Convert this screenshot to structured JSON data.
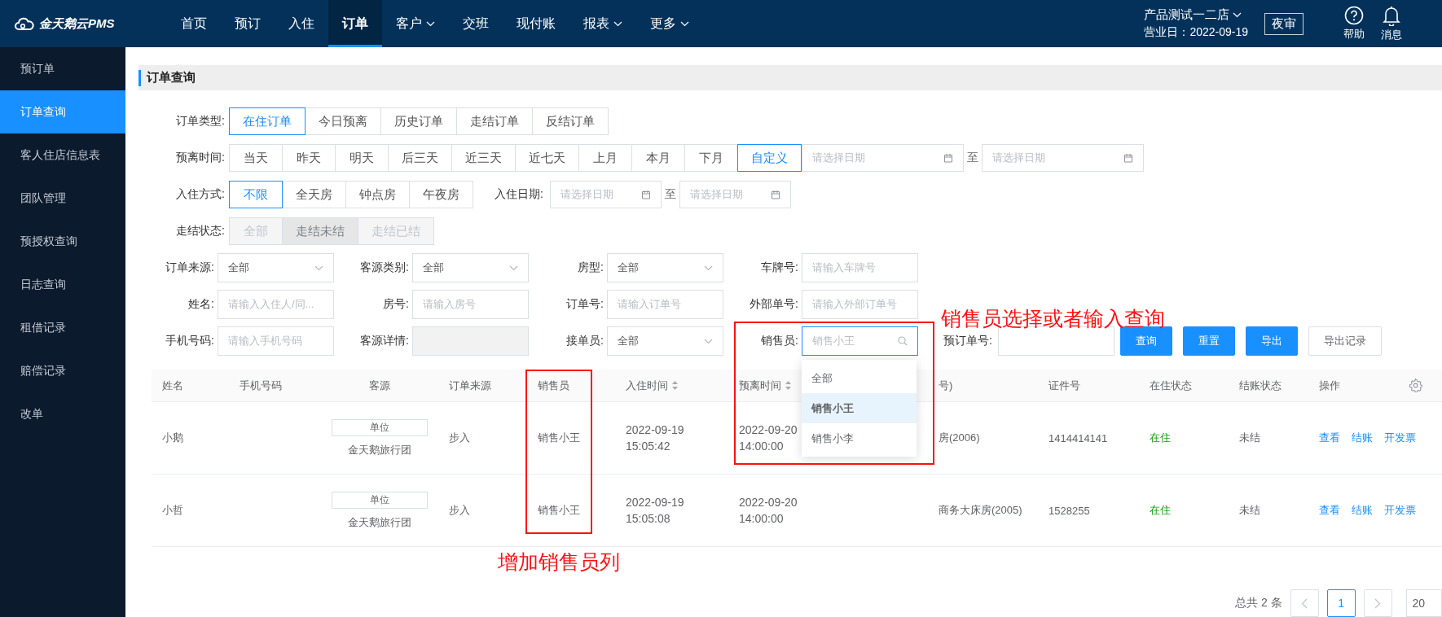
{
  "topbar": {
    "logo": "金天鹅云PMS",
    "nav": [
      {
        "label": "首页",
        "selected": false,
        "has_menu": false
      },
      {
        "label": "预订",
        "selected": false,
        "has_menu": false
      },
      {
        "label": "入住",
        "selected": false,
        "has_menu": false
      },
      {
        "label": "订单",
        "selected": true,
        "has_menu": false
      },
      {
        "label": "客户",
        "selected": false,
        "has_menu": true
      },
      {
        "label": "交班",
        "selected": false,
        "has_menu": false
      },
      {
        "label": "现付账",
        "selected": false,
        "has_menu": false
      },
      {
        "label": "报表",
        "selected": false,
        "has_menu": true
      },
      {
        "label": "更多",
        "selected": false,
        "has_menu": true
      }
    ],
    "store": "产品测试一二店",
    "business_day": "营业日：2022-09-19",
    "night_audit": "夜审",
    "tools": [
      {
        "kind": "help",
        "label": "帮助"
      },
      {
        "kind": "bell",
        "label": "消息"
      }
    ]
  },
  "sidebar": {
    "items": [
      {
        "label": "预订单",
        "selected": false
      },
      {
        "label": "订单查询",
        "selected": true
      },
      {
        "label": "客人住店信息表",
        "selected": false
      },
      {
        "label": "团队管理",
        "selected": false
      },
      {
        "label": "预授权查询",
        "selected": false
      },
      {
        "label": "日志查询",
        "selected": false
      },
      {
        "label": "租借记录",
        "selected": false
      },
      {
        "label": "赔偿记录",
        "selected": false
      },
      {
        "label": "改单",
        "selected": false
      }
    ]
  },
  "page_title": "订单查询",
  "filter_rows": [
    {
      "label": "订单类型:",
      "disabled": false,
      "options": [
        {
          "label": "在住订单",
          "selected": true
        },
        {
          "label": "今日预离",
          "selected": false
        },
        {
          "label": "历史订单",
          "selected": false
        },
        {
          "label": "走结订单",
          "selected": false
        },
        {
          "label": "反结订单",
          "selected": false
        }
      ]
    },
    {
      "label": "预离时间:",
      "disabled": false,
      "options": [
        {
          "label": "当天",
          "selected": false
        },
        {
          "label": "昨天",
          "selected": false
        },
        {
          "label": "明天",
          "selected": false
        },
        {
          "label": "后三天",
          "selected": false
        },
        {
          "label": "近三天",
          "selected": false
        },
        {
          "label": "近七天",
          "selected": false
        },
        {
          "label": "上月",
          "selected": false
        },
        {
          "label": "本月",
          "selected": false
        },
        {
          "label": "下月",
          "selected": false
        },
        {
          "label": "自定义",
          "selected": true
        }
      ],
      "date_range": {
        "start_placeholder": "请选择日期",
        "separator": "至",
        "end_placeholder": "请选择日期"
      }
    },
    {
      "label": "入住方式:",
      "disabled": false,
      "options": [
        {
          "label": "不限",
          "selected": true
        },
        {
          "label": "全天房",
          "selected": false
        },
        {
          "label": "钟点房",
          "selected": false
        },
        {
          "label": "午夜房",
          "selected": false
        }
      ],
      "date_range": {
        "label": "入住日期:",
        "start_placeholder": "请选择日期",
        "separator": "至",
        "end_placeholder": "请选择日期"
      }
    },
    {
      "label": "走结状态:",
      "disabled": true,
      "options": [
        {
          "label": "全部",
          "selected": false
        },
        {
          "label": "走结未结",
          "selected": true
        },
        {
          "label": "走结已结",
          "selected": false
        }
      ]
    }
  ],
  "field_rows": [
    [
      {
        "label": "订单来源:",
        "kind": "select",
        "value": "全部",
        "disabled": false,
        "focused": false
      },
      {
        "label": "客源类别:",
        "kind": "select",
        "value": "全部",
        "disabled": false,
        "focused": false
      },
      {
        "label": "房型:",
        "kind": "select",
        "value": "全部",
        "disabled": false,
        "focused": false
      },
      {
        "label": "车牌号:",
        "kind": "text",
        "placeholder": "请输入车牌号",
        "disabled": false,
        "focused": false
      }
    ],
    [
      {
        "label": "姓名:",
        "kind": "text",
        "placeholder": "请输入入住人/同...",
        "disabled": false,
        "focused": false
      },
      {
        "label": "房号:",
        "kind": "text",
        "placeholder": "请输入房号",
        "disabled": false,
        "focused": false
      },
      {
        "label": "订单号:",
        "kind": "text",
        "placeholder": "请输入订单号",
        "disabled": false,
        "focused": false
      },
      {
        "label": "外部单号:",
        "kind": "text",
        "placeholder": "请输入外部订单号",
        "disabled": false,
        "focused": false
      }
    ],
    [
      {
        "label": "手机号码:",
        "kind": "text",
        "placeholder": "请输入手机号码",
        "disabled": false,
        "focused": false
      },
      {
        "label": "客源详情:",
        "kind": "text",
        "disabled": true,
        "focused": false
      },
      {
        "label": "接单员:",
        "kind": "select",
        "value": "全部",
        "disabled": false,
        "focused": false
      },
      {
        "label": "销售员:",
        "kind": "search",
        "placeholder": "销售小王",
        "disabled": false,
        "focused": true,
        "options": [
          {
            "label": "全部",
            "selected": false
          },
          {
            "label": "销售小王",
            "selected": true
          },
          {
            "label": "销售小李",
            "selected": false
          }
        ]
      },
      {
        "label": "预订单号:",
        "kind": "text",
        "disabled": false,
        "focused": false
      }
    ]
  ],
  "actions": [
    {
      "label": "查询",
      "kind": "primary"
    },
    {
      "label": "重置",
      "kind": "primary"
    },
    {
      "label": "导出",
      "kind": "primary"
    },
    {
      "label": "导出记录",
      "kind": "default"
    }
  ],
  "table": {
    "columns": [
      {
        "label": "姓名",
        "sortable": false
      },
      {
        "label": "手机号码",
        "sortable": false
      },
      {
        "label": "客源",
        "sortable": false
      },
      {
        "label": "订单来源",
        "sortable": false
      },
      {
        "label": "销售员",
        "sortable": false
      },
      {
        "label": "入住时间",
        "sortable": true
      },
      {
        "label": "预离时间",
        "sortable": true
      },
      {
        "label": "号)",
        "sortable": false
      },
      {
        "label": "证件号",
        "sortable": false
      },
      {
        "label": "在住状态",
        "sortable": false
      },
      {
        "label": "结账状态",
        "sortable": false
      },
      {
        "label": "操作",
        "sortable": false
      }
    ],
    "rows": [
      {
        "name": "小鹅",
        "source_tag": "单位",
        "source_name": "金天鹅旅行团",
        "order_source": "步入",
        "salesperson": "销售小王",
        "checkin_time": "2022-09-19 15:05:42",
        "departure_time": "2022-09-20 14:00:00",
        "room": "房(2006)",
        "id_number": "1414414141",
        "stay_status": "在住",
        "bill_status": "未结",
        "actions": [
          "查看",
          "结账",
          "开发票"
        ]
      },
      {
        "name": "小哲",
        "source_tag": "单位",
        "source_name": "金天鹅旅行团",
        "order_source": "步入",
        "salesperson": "销售小王",
        "checkin_time": "2022-09-19 15:05:08",
        "departure_time": "2022-09-20 14:00:00",
        "room": "商务大床房(2005)",
        "id_number": "1528255",
        "stay_status": "在住",
        "bill_status": "未结",
        "actions": [
          "查看",
          "结账",
          "开发票"
        ]
      }
    ]
  },
  "pagination": {
    "total": "总共 2 条",
    "pages": [
      {
        "label": "1",
        "selected": true
      }
    ],
    "page_size": "20"
  },
  "annotations": [
    {
      "text": "销售员选择或者输入查询"
    },
    {
      "text": "增加销售员列"
    }
  ]
}
